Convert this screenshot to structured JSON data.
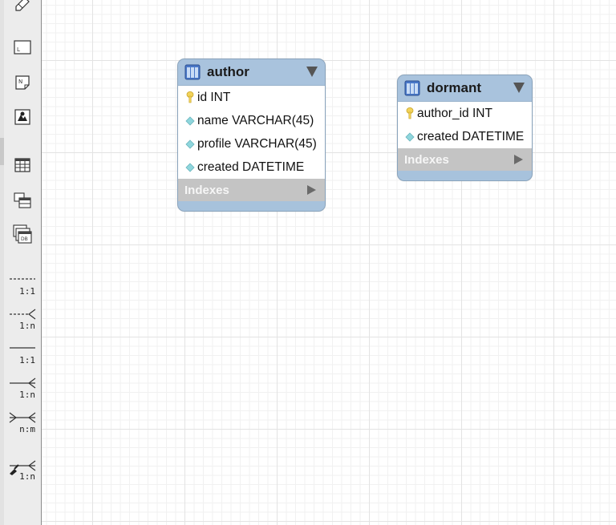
{
  "toolbar": {
    "tools": [
      {
        "name": "eraser-tool-icon"
      },
      {
        "name": "layer-tool-icon"
      },
      {
        "name": "note-tool-icon"
      },
      {
        "name": "image-tool-icon"
      },
      {
        "name": "table-tool-icon"
      },
      {
        "name": "view-tool-icon"
      },
      {
        "name": "routine-group-tool-icon"
      }
    ],
    "relationships": [
      {
        "label": "1:1",
        "style": "dashed",
        "kind": "one"
      },
      {
        "label": "1:n",
        "style": "dashed",
        "kind": "many"
      },
      {
        "label": "1:1",
        "style": "solid",
        "kind": "one"
      },
      {
        "label": "1:n",
        "style": "solid",
        "kind": "many"
      },
      {
        "label": "n:m",
        "style": "solid",
        "kind": "manytomany"
      },
      {
        "label": "1:n",
        "style": "solid",
        "kind": "pick"
      }
    ]
  },
  "tables": [
    {
      "title": "author",
      "columns": [
        {
          "text": "id INT",
          "icon": "primary-key-icon"
        },
        {
          "text": "name VARCHAR(45)",
          "icon": "column-diamond-icon"
        },
        {
          "text": "profile VARCHAR(45)",
          "icon": "column-diamond-icon"
        },
        {
          "text": "created DATETIME",
          "icon": "column-diamond-icon"
        }
      ],
      "indexes_label": "Indexes"
    },
    {
      "title": "dormant",
      "columns": [
        {
          "text": "author_id INT",
          "icon": "primary-key-icon"
        },
        {
          "text": "created DATETIME",
          "icon": "column-diamond-icon"
        }
      ],
      "indexes_label": "Indexes"
    }
  ],
  "colors": {
    "header": "#a9c3dd",
    "indexes_bar": "#c4c4c4",
    "key": "#f2d35a",
    "diamond": "#8fd6dd"
  }
}
